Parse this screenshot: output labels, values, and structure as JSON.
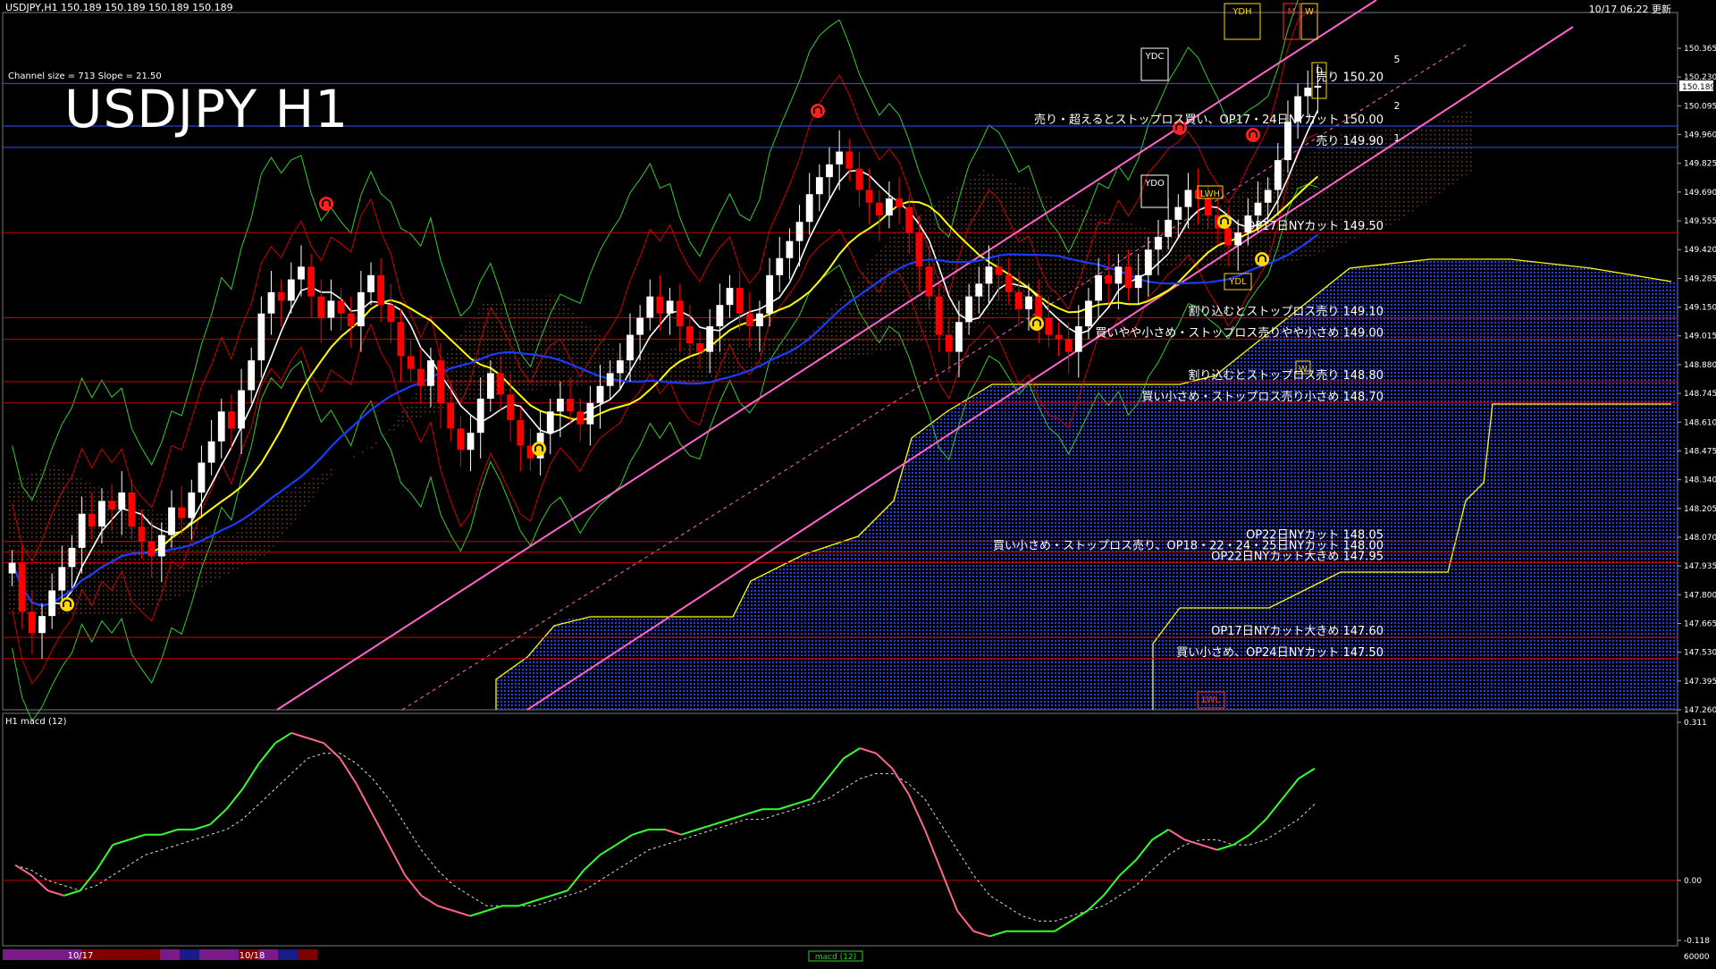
{
  "header": {
    "symbol_info": "USDJPY,H1  150.189 150.189 150.189 150.189",
    "datetime": "10/17 06:22 更新",
    "channel_info": "Channel size = 713 Slope = 21.50",
    "title": "USDJPY H1",
    "macd_label": "H1  macd (12)"
  },
  "chart_data": [
    {
      "type": "candlestick",
      "title": "USDJPY H1",
      "ylim": [
        147.26,
        150.365
      ],
      "y_ticks": [
        "150.365",
        "150.230",
        "150.095",
        "149.960",
        "149.825",
        "149.690",
        "149.555",
        "149.420",
        "149.285",
        "149.150",
        "149.015",
        "148.880",
        "148.745",
        "148.610",
        "148.475",
        "148.340",
        "148.205",
        "148.070",
        "147.935",
        "147.800",
        "147.665",
        "147.530",
        "147.395",
        "147.260"
      ],
      "current_price": "150.189",
      "grid": false,
      "series_close": [
        147.95,
        147.72,
        147.62,
        147.7,
        147.82,
        147.93,
        148.02,
        148.18,
        148.12,
        148.24,
        148.2,
        148.28,
        148.12,
        148.05,
        147.98,
        148.08,
        148.21,
        148.16,
        148.28,
        148.42,
        148.52,
        148.66,
        148.58,
        148.76,
        148.9,
        149.12,
        149.22,
        149.18,
        149.28,
        149.34,
        149.2,
        149.1,
        149.18,
        149.12,
        149.06,
        149.22,
        149.3,
        149.16,
        149.08,
        148.92,
        148.86,
        148.78,
        148.9,
        148.7,
        148.58,
        148.48,
        148.56,
        148.72,
        148.84,
        148.74,
        148.62,
        148.5,
        148.44,
        148.56,
        148.66,
        148.72,
        148.66,
        148.6,
        148.7,
        148.78,
        148.84,
        148.9,
        149.02,
        149.1,
        149.2,
        149.12,
        149.18,
        149.06,
        148.98,
        148.94,
        149.06,
        149.16,
        149.24,
        149.12,
        149.06,
        149.12,
        149.3,
        149.38,
        149.46,
        149.55,
        149.68,
        149.76,
        149.82,
        149.88,
        149.8,
        149.7,
        149.64,
        149.58,
        149.66,
        149.62,
        149.5,
        149.34,
        149.2,
        149.02,
        148.94,
        149.08,
        149.2,
        149.26,
        149.34,
        149.3,
        149.22,
        149.14,
        149.2,
        149.1,
        149.02,
        149.0,
        148.94,
        149.06,
        149.18,
        149.3,
        149.26,
        149.34,
        149.24,
        149.3,
        149.42,
        149.48,
        149.56,
        149.62,
        149.7,
        149.66,
        149.58,
        149.52,
        149.44,
        149.5,
        149.58,
        149.64,
        149.7,
        149.84,
        150.02,
        150.14,
        150.18,
        150.189
      ],
      "horizontal_levels": [
        {
          "price": 150.2,
          "label": "売り 150.20"
        },
        {
          "price": 150.0,
          "label": "売り・超えるとストップロス買い、OP17・24日NYカット 150.00"
        },
        {
          "price": 149.9,
          "label": "売り 149.90"
        },
        {
          "price": 149.5,
          "label": "OP17日NYカット 149.50"
        },
        {
          "price": 149.1,
          "label": "割り込むとストップロス売り 149.10"
        },
        {
          "price": 149.0,
          "label": "買いやや小さめ・ストップロス売りやや小さめ 149.00"
        },
        {
          "price": 148.8,
          "label": "割り込むとストップロス売り 148.80"
        },
        {
          "price": 148.7,
          "label": "買い小さめ・ストップロス売り小さめ 148.70"
        },
        {
          "price": 148.05,
          "label": "OP22日NYカット 148.05"
        },
        {
          "price": 148.0,
          "label": "買い小さめ・ストップロス売り、OP18・22・24・25日NYカット 148.00"
        },
        {
          "price": 147.95,
          "label": "OP22日NYカット大きめ 147.95"
        },
        {
          "price": 147.6,
          "label": "OP17日NYカット大きめ 147.60"
        },
        {
          "price": 147.5,
          "label": "買い小さめ、OP24日NYカット 147.50"
        }
      ],
      "markers": [
        "YDH",
        "M",
        "W",
        "YDC",
        "D",
        "YDO",
        "LWH",
        "YDL",
        "LWL",
        "W"
      ],
      "channel_marks": [
        "5",
        "2",
        "1"
      ]
    },
    {
      "type": "line",
      "title": "H1  macd (12)",
      "ylim": [
        -0.118,
        0.311
      ],
      "y_ticks": [
        "0.311",
        "0.00",
        "-0.118"
      ],
      "macd": [
        0.03,
        0.01,
        -0.02,
        -0.03,
        -0.02,
        0.02,
        0.07,
        0.08,
        0.09,
        0.09,
        0.1,
        0.1,
        0.11,
        0.14,
        0.18,
        0.23,
        0.27,
        0.29,
        0.28,
        0.27,
        0.24,
        0.19,
        0.13,
        0.07,
        0.01,
        -0.03,
        -0.05,
        -0.06,
        -0.07,
        -0.06,
        -0.05,
        -0.05,
        -0.04,
        -0.03,
        -0.02,
        0.02,
        0.05,
        0.07,
        0.09,
        0.1,
        0.1,
        0.09,
        0.1,
        0.11,
        0.12,
        0.13,
        0.14,
        0.14,
        0.15,
        0.16,
        0.2,
        0.24,
        0.26,
        0.25,
        0.22,
        0.17,
        0.1,
        0.02,
        -0.06,
        -0.1,
        -0.11,
        -0.1,
        -0.1,
        -0.1,
        -0.1,
        -0.08,
        -0.06,
        -0.03,
        0.01,
        0.04,
        0.08,
        0.1,
        0.08,
        0.07,
        0.06,
        0.07,
        0.09,
        0.12,
        0.16,
        0.2,
        0.22
      ],
      "signal": [
        0.03,
        0.02,
        0.0,
        -0.01,
        -0.02,
        -0.01,
        0.01,
        0.03,
        0.05,
        0.06,
        0.07,
        0.08,
        0.09,
        0.1,
        0.12,
        0.15,
        0.18,
        0.21,
        0.24,
        0.25,
        0.25,
        0.23,
        0.2,
        0.16,
        0.11,
        0.06,
        0.02,
        -0.01,
        -0.03,
        -0.05,
        -0.05,
        -0.05,
        -0.05,
        -0.04,
        -0.03,
        -0.02,
        0.0,
        0.02,
        0.04,
        0.06,
        0.07,
        0.08,
        0.09,
        0.1,
        0.11,
        0.12,
        0.12,
        0.13,
        0.14,
        0.15,
        0.16,
        0.18,
        0.2,
        0.21,
        0.21,
        0.19,
        0.16,
        0.11,
        0.06,
        0.01,
        -0.03,
        -0.05,
        -0.07,
        -0.08,
        -0.08,
        -0.07,
        -0.06,
        -0.05,
        -0.03,
        -0.01,
        0.02,
        0.05,
        0.07,
        0.08,
        0.08,
        0.07,
        0.07,
        0.08,
        0.1,
        0.12,
        0.15
      ]
    }
  ],
  "bottom_bar": {
    "date1": "10/17",
    "date2": "10/18",
    "indicator_label": "macd (12)",
    "right_value": "60000"
  },
  "colors": {
    "background": "#000000",
    "bull_candle": "#ffffff",
    "bear_candle": "#ff0000",
    "ma_fast": "#ffffff",
    "ma_mid": "#ffff00",
    "ma_slow": "#1a3cff",
    "ichimoku": "#ffff00",
    "channel": "#ff66cc",
    "level_line": "#c80000",
    "macd_up": "#33ff33",
    "macd_down": "#ff6688"
  }
}
